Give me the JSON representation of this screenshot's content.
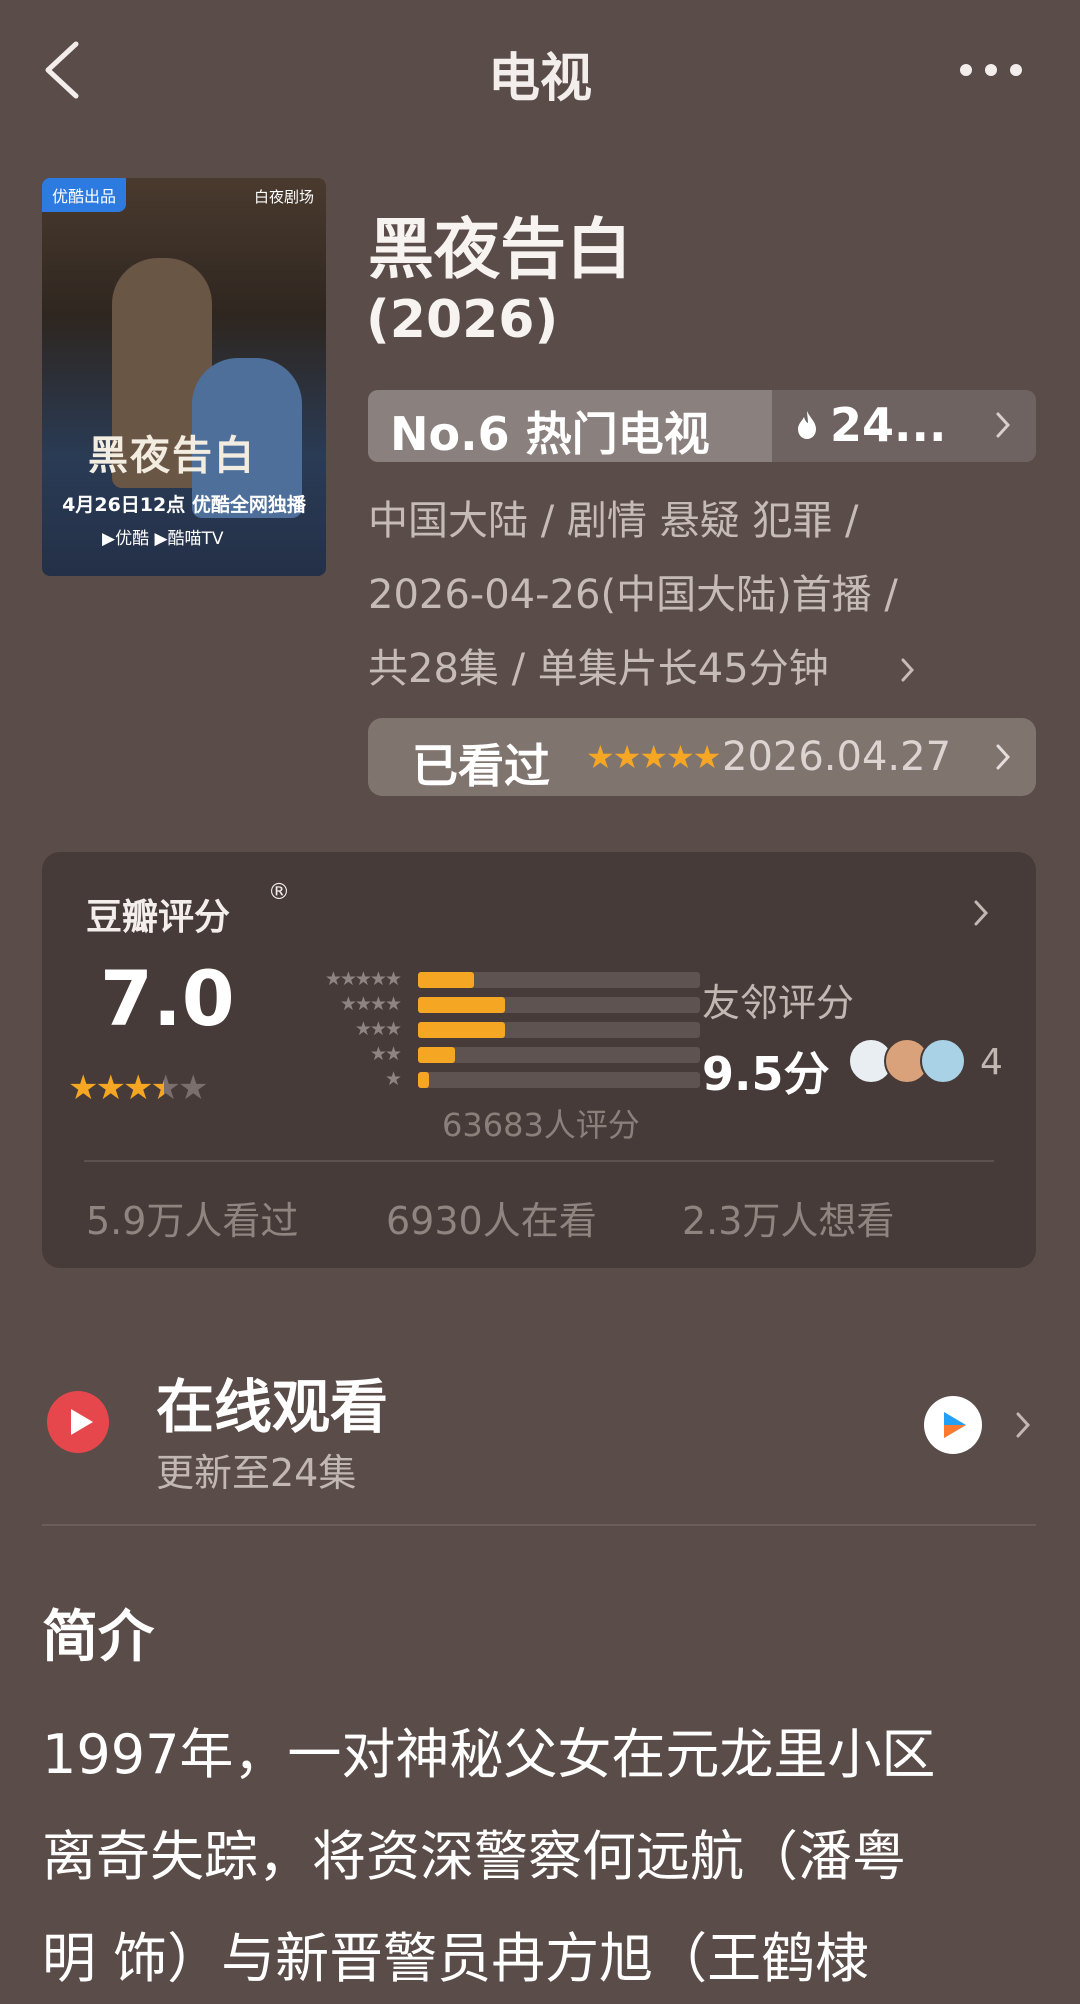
{
  "header": {
    "title": "电视",
    "back_icon": "back-chevron-icon",
    "more_icon": "more-dots-icon"
  },
  "poster": {
    "badge": "优酷出品",
    "logo": "白夜剧场",
    "calligraphy": "黑夜告白",
    "date_line": "4月26日12点 优酷全网独播",
    "platforms": "▶优酷  ▶酷喵TV"
  },
  "show": {
    "title": "黑夜告白",
    "year": "(2026)",
    "rank": "No.6 热门电视",
    "heat": "24...",
    "meta": [
      "中国大陆 / 剧情 悬疑 犯罪 /",
      "2026-04-26(中国大陆)首播 /",
      "共28集 / 单集片长45分钟"
    ]
  },
  "watched": {
    "label": "已看过",
    "stars": "★★★★★",
    "date": "2026.04.27"
  },
  "rating": {
    "title": "豆瓣评分",
    "registered": "®",
    "score": "7.0",
    "stars_value": 3.5,
    "histogram": [
      {
        "stars": "★★★★★",
        "fraction": 0.2
      },
      {
        "stars": "★★★★",
        "fraction": 0.31
      },
      {
        "stars": "★★★",
        "fraction": 0.31
      },
      {
        "stars": "★★",
        "fraction": 0.13
      },
      {
        "stars": "★",
        "fraction": 0.04
      }
    ],
    "count": "63683人评分",
    "friends_label": "友邻评分",
    "friends_score": "9.5分",
    "friends_count": "4",
    "stats": [
      "5.9万人看过",
      "6930人在看",
      "2.3万人想看"
    ]
  },
  "watch": {
    "title": "在线观看",
    "subtitle": "更新至24集",
    "platform_icon": "youku-icon"
  },
  "intro": {
    "title": "简介",
    "lines": [
      "1997年，一对神秘父女在元龙里小区",
      "离奇失踪，将资深警察何远航（潘粤",
      "明 饰）与新晋警员冉方旭（王鹤棣"
    ]
  },
  "colors": {
    "background": "#5a4c48",
    "card": "#463b38",
    "accent_star": "#f5a623",
    "play_red": "#e6474c"
  }
}
